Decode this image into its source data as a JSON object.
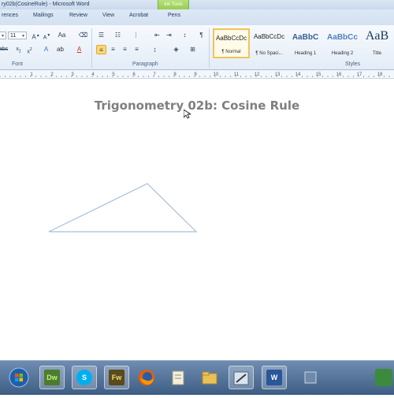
{
  "window": {
    "title": "ry02b(CosineRule) - Microsoft Word",
    "ink_tools": "Ink Tools"
  },
  "tabs": [
    {
      "label": "rences"
    },
    {
      "label": "Mailings"
    },
    {
      "label": "Review"
    },
    {
      "label": "View"
    },
    {
      "label": "Acrobat"
    },
    {
      "label": "Pens"
    }
  ],
  "ribbon": {
    "font_size": "11",
    "group_font": "Font",
    "group_paragraph": "Paragraph",
    "group_styles": "Styles",
    "styles": [
      {
        "sample": "AaBbCcDc",
        "name": "¶ Normal",
        "selected": true
      },
      {
        "sample": "AaBbCcDc",
        "name": "¶ No Spaci..."
      },
      {
        "sample": "AaBbC",
        "name": "Heading 1"
      },
      {
        "sample": "AaBbCc",
        "name": "Heading 2"
      },
      {
        "sample": "AaB",
        "name": "Title"
      }
    ]
  },
  "ruler": {
    "numbers": [
      "1",
      "2",
      "3",
      "4",
      "5",
      "6",
      "7",
      "8",
      "9",
      "10",
      "11",
      "12",
      "13",
      "14",
      "15",
      "16",
      "17",
      "18"
    ]
  },
  "document": {
    "title": "Trigonometry 02b: Cosine Rule",
    "triangle_stroke": "#a9bfd8"
  },
  "taskbar": {
    "dw_label": "Dw",
    "fw_label": "Fw",
    "w_label": "W"
  },
  "colors": {
    "title_gray": "#7f7f7f",
    "taskbar": "#4a6a92",
    "ink_tools_green": "#86c440"
  }
}
